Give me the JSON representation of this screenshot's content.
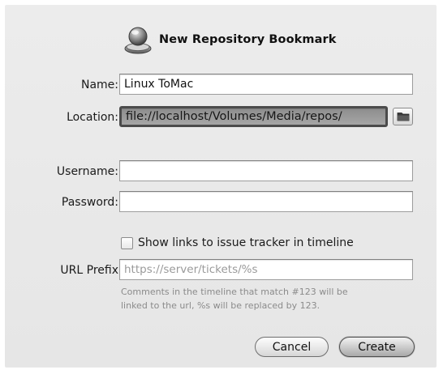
{
  "dialog": {
    "title": "New Repository Bookmark",
    "icon": "repository-icon"
  },
  "form": {
    "name_label": "Name:",
    "name_value": "Linux ToMac",
    "location_label": "Location:",
    "location_value": "file://localhost/Volumes/Media/repos/",
    "browse_icon": "folder-icon",
    "username_label": "Username:",
    "username_value": "",
    "password_label": "Password:",
    "password_value": "",
    "show_links_label": "Show links to issue tracker in timeline",
    "show_links_checked": false,
    "url_prefix_label": "URL Prefix",
    "url_prefix_value": "https://server/tickets/%s",
    "help_line1": "Comments in the timeline that match #123 will be",
    "help_line2": "linked to the url, %s will be replaced by 123."
  },
  "buttons": {
    "cancel_label": "Cancel",
    "create_label": "Create"
  }
}
